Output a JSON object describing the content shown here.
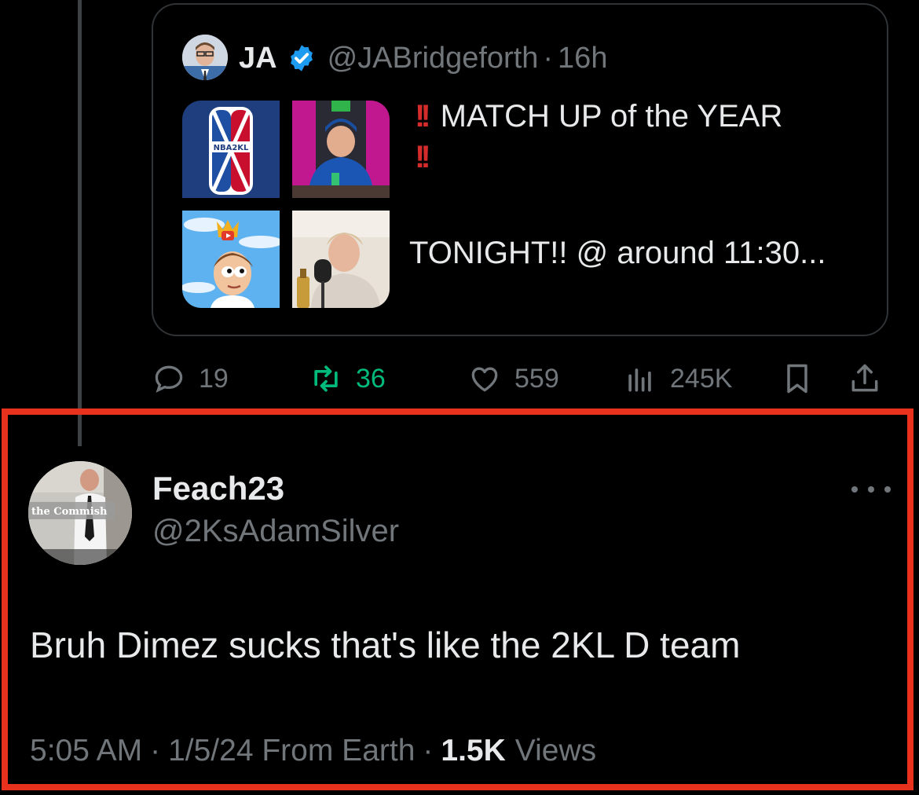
{
  "quoted_tweet": {
    "author_name": "JA",
    "handle": "@JABridgeforth",
    "time": "16h",
    "text_line_1": "MATCH UP of the YEAR",
    "bang_1": "!!",
    "bang_2": "!!",
    "text_line_2": "TONIGHT!! @ around 11:30...",
    "logo_text": "NBA2KL",
    "avatar_icon": "profile-photo",
    "verified_color": "#1d9bf0"
  },
  "actions": {
    "replies": "19",
    "retweets": "36",
    "likes": "559",
    "views": "245K"
  },
  "reply": {
    "display_name": "Feach23",
    "handle": "@2KsAdamSilver",
    "avatar_caption": "the Commish",
    "body": "Bruh Dimez sucks that's like the 2KL D team",
    "time": "5:05 AM",
    "date_location": "1/5/24 From Earth",
    "views_count": "1.5K",
    "views_label": "Views",
    "separator": "·"
  },
  "colors": {
    "background": "#000000",
    "highlight_border": "#e8321e",
    "retweet_green": "#00ba7c",
    "muted": "#71767b"
  }
}
